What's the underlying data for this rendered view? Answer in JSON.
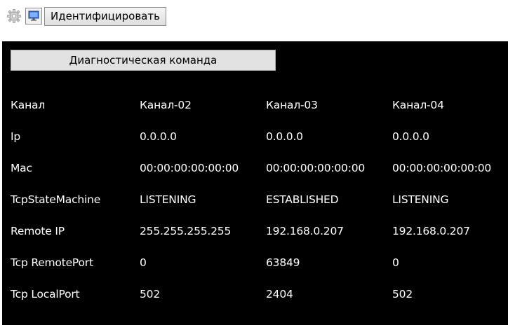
{
  "toolbar": {
    "settings_icon": "gear-icon",
    "monitor_icon": "monitor-icon",
    "identify_label": "Идентифицировать"
  },
  "panel": {
    "diagnostic_label": "Диагностическая команда",
    "rows": [
      {
        "label": "Канал",
        "values": [
          "Канал-02",
          "Канал-03",
          "Канал-04"
        ]
      },
      {
        "label": "Ip",
        "values": [
          "0.0.0.0",
          "0.0.0.0",
          "0.0.0.0"
        ]
      },
      {
        "label": "Mac",
        "values": [
          "00:00:00:00:00:00",
          "00:00:00:00:00:00",
          "00:00:00:00:00:00"
        ]
      },
      {
        "label": "TcpStateMachine",
        "values": [
          "LISTENING",
          "ESTABLISHED",
          "LISTENING"
        ]
      },
      {
        "label": "Remote IP",
        "values": [
          "255.255.255.255",
          "192.168.0.207",
          "192.168.0.207"
        ]
      },
      {
        "label": "Tcp RemotePort",
        "values": [
          "0",
          "63849",
          "0"
        ]
      },
      {
        "label": "Tcp LocalPort",
        "values": [
          "502",
          "2404",
          "502"
        ]
      }
    ]
  },
  "colors": {
    "panel_background": "#000000",
    "panel_text": "#ffffff",
    "button_background": "#e1e1e1"
  }
}
